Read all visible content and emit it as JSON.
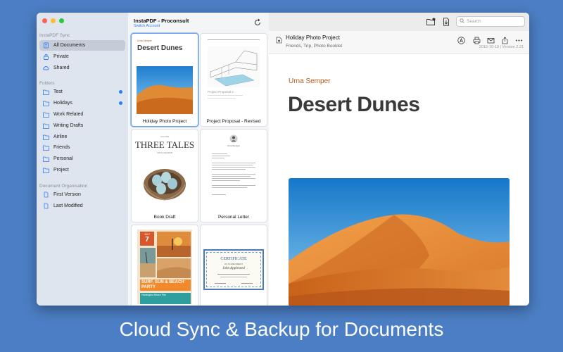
{
  "sidebar": {
    "sync_section": "InstaPDF Sync",
    "sync_items": [
      {
        "label": "All Documents",
        "icon": "documents-icon"
      },
      {
        "label": "Private",
        "icon": "lock-icon"
      },
      {
        "label": "Shared",
        "icon": "cloud-icon"
      }
    ],
    "folders_section": "Folders",
    "folders": [
      {
        "label": "Test",
        "unread": true
      },
      {
        "label": "Holidays",
        "unread": true
      },
      {
        "label": "Work Related",
        "unread": false
      },
      {
        "label": "Writing Drafts",
        "unread": false
      },
      {
        "label": "Airline",
        "unread": false
      },
      {
        "label": "Friends",
        "unread": false
      },
      {
        "label": "Personal",
        "unread": false
      },
      {
        "label": "Project",
        "unread": false
      }
    ],
    "org_section": "Document Organisation",
    "org_items": [
      {
        "label": "First Version",
        "icon": "doc-version-icon"
      },
      {
        "label": "Last Modified",
        "icon": "doc-modified-icon"
      }
    ]
  },
  "doclist": {
    "title": "InstaPDF - Proconsult",
    "switch_account": "Switch Account",
    "cards": [
      {
        "label": "Holiday Photo Project",
        "thumb_title": "Desert Dunes",
        "thumb_author": "Urna Semper"
      },
      {
        "label": "Project Proposal - Revised",
        "thumb_text": "Project Proposal 2"
      },
      {
        "label": "Book Draft",
        "thumb_title": "THREE TALES",
        "thumb_kicker": "VOLUME",
        "thumb_author": "URNA SEMPER"
      },
      {
        "label": "Personal Letter",
        "thumb_name": "Urna Semper"
      },
      {
        "label": "",
        "thumb_month": "JULY",
        "thumb_day": "7",
        "thumb_title": "SURF, SUN & BEACH PARTY",
        "thumb_sub": "Huntington Beach Pier"
      },
      {
        "label": "",
        "thumb_title": "CERTIFICATE",
        "thumb_sub": "OF ACHIEVEMENT",
        "thumb_name": "John Appleseed"
      }
    ]
  },
  "toolbar": {
    "search_placeholder": "Search"
  },
  "document": {
    "title": "Holiday Photo Project",
    "tags": "Friends, Trip, Photo Booklet",
    "meta": "2015-10-19 | Version 2.21",
    "author": "Urna Semper",
    "heading": "Desert Dunes"
  },
  "caption": "Cloud Sync & Backup for Documents",
  "colors": {
    "background": "#4b7ec4",
    "accent": "#2f7df6",
    "author": "#b35a1c"
  }
}
